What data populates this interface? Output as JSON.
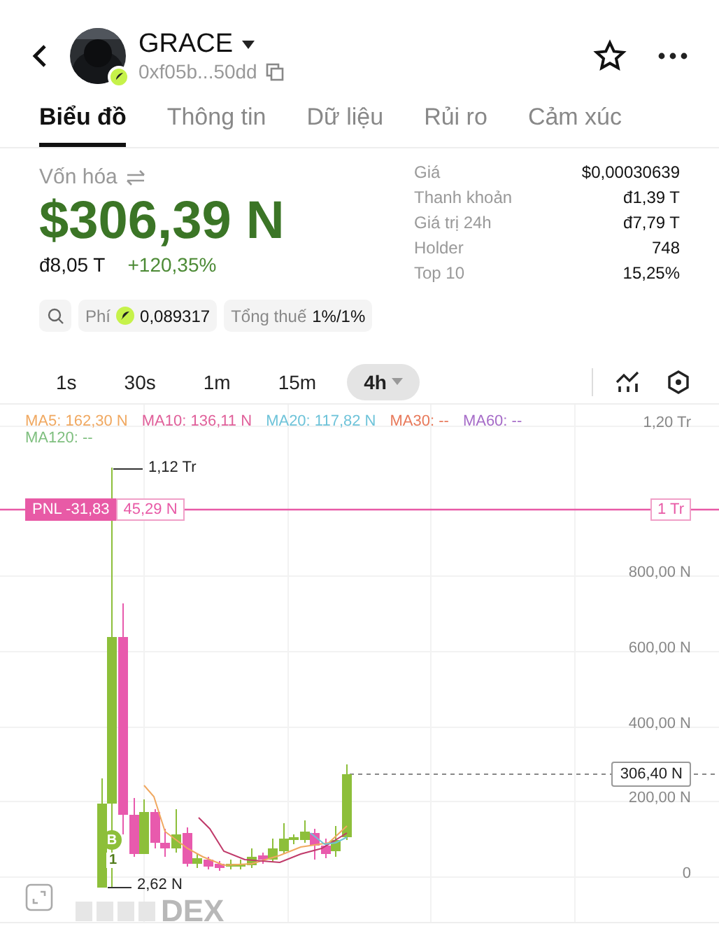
{
  "header": {
    "name": "GRACE",
    "address": "0xf05b...50dd"
  },
  "tabs": [
    {
      "label": "Biểu đồ",
      "selected": true
    },
    {
      "label": "Thông tin",
      "selected": false
    },
    {
      "label": "Dữ liệu",
      "selected": false
    },
    {
      "label": "Rủi ro",
      "selected": false
    },
    {
      "label": "Cảm xúc",
      "selected": false
    }
  ],
  "market_cap": {
    "label": "Vốn hóa",
    "value": "$306,39 N",
    "sub_value": "đ8,05 T",
    "change": "+120,35%"
  },
  "stats": [
    {
      "label": "Giá",
      "value": "$0,00030639"
    },
    {
      "label": "Thanh khoản",
      "value": "đ1,39 T"
    },
    {
      "label": "Giá trị 24h",
      "value": "đ7,79 T"
    },
    {
      "label": "Holder",
      "value": "748"
    },
    {
      "label": "Top 10",
      "value": "15,25%"
    }
  ],
  "chips": {
    "fee_label": "Phí",
    "fee_value": "0,089317",
    "tax_label": "Tổng thuế",
    "tax_value": "1%/1%"
  },
  "intervals": [
    {
      "label": "1s",
      "selected": false
    },
    {
      "label": "30s",
      "selected": false
    },
    {
      "label": "1m",
      "selected": false
    },
    {
      "label": "15m",
      "selected": false
    },
    {
      "label": "4h",
      "selected": true
    }
  ],
  "chart": {
    "indicators": [
      {
        "label": "MA5: 162,30 N",
        "color": "#f0a860"
      },
      {
        "label": "MA10: 136,11 N",
        "color": "#e0609a"
      },
      {
        "label": "MA20: 117,82 N",
        "color": "#6ec3d9"
      },
      {
        "label": "MA30: --",
        "color": "#e8795a"
      },
      {
        "label": "MA60: --",
        "color": "#a66cc8"
      },
      {
        "label": "MA120: --",
        "color": "#7fbf7f"
      }
    ],
    "y_labels": [
      "1,20 Tr",
      "800,00 N",
      "600,00 N",
      "400,00 N",
      "200,00 N",
      "0"
    ],
    "high_label": "1,12 Tr",
    "low_label": "2,62 N",
    "pnl": {
      "label": "PNL -31,83",
      "value": "45,29 N",
      "level_label": "1 Tr"
    },
    "current_price": "306,40 N",
    "watermark": "DEX",
    "trade_marker": {
      "label": "B",
      "count": "1"
    }
  }
}
